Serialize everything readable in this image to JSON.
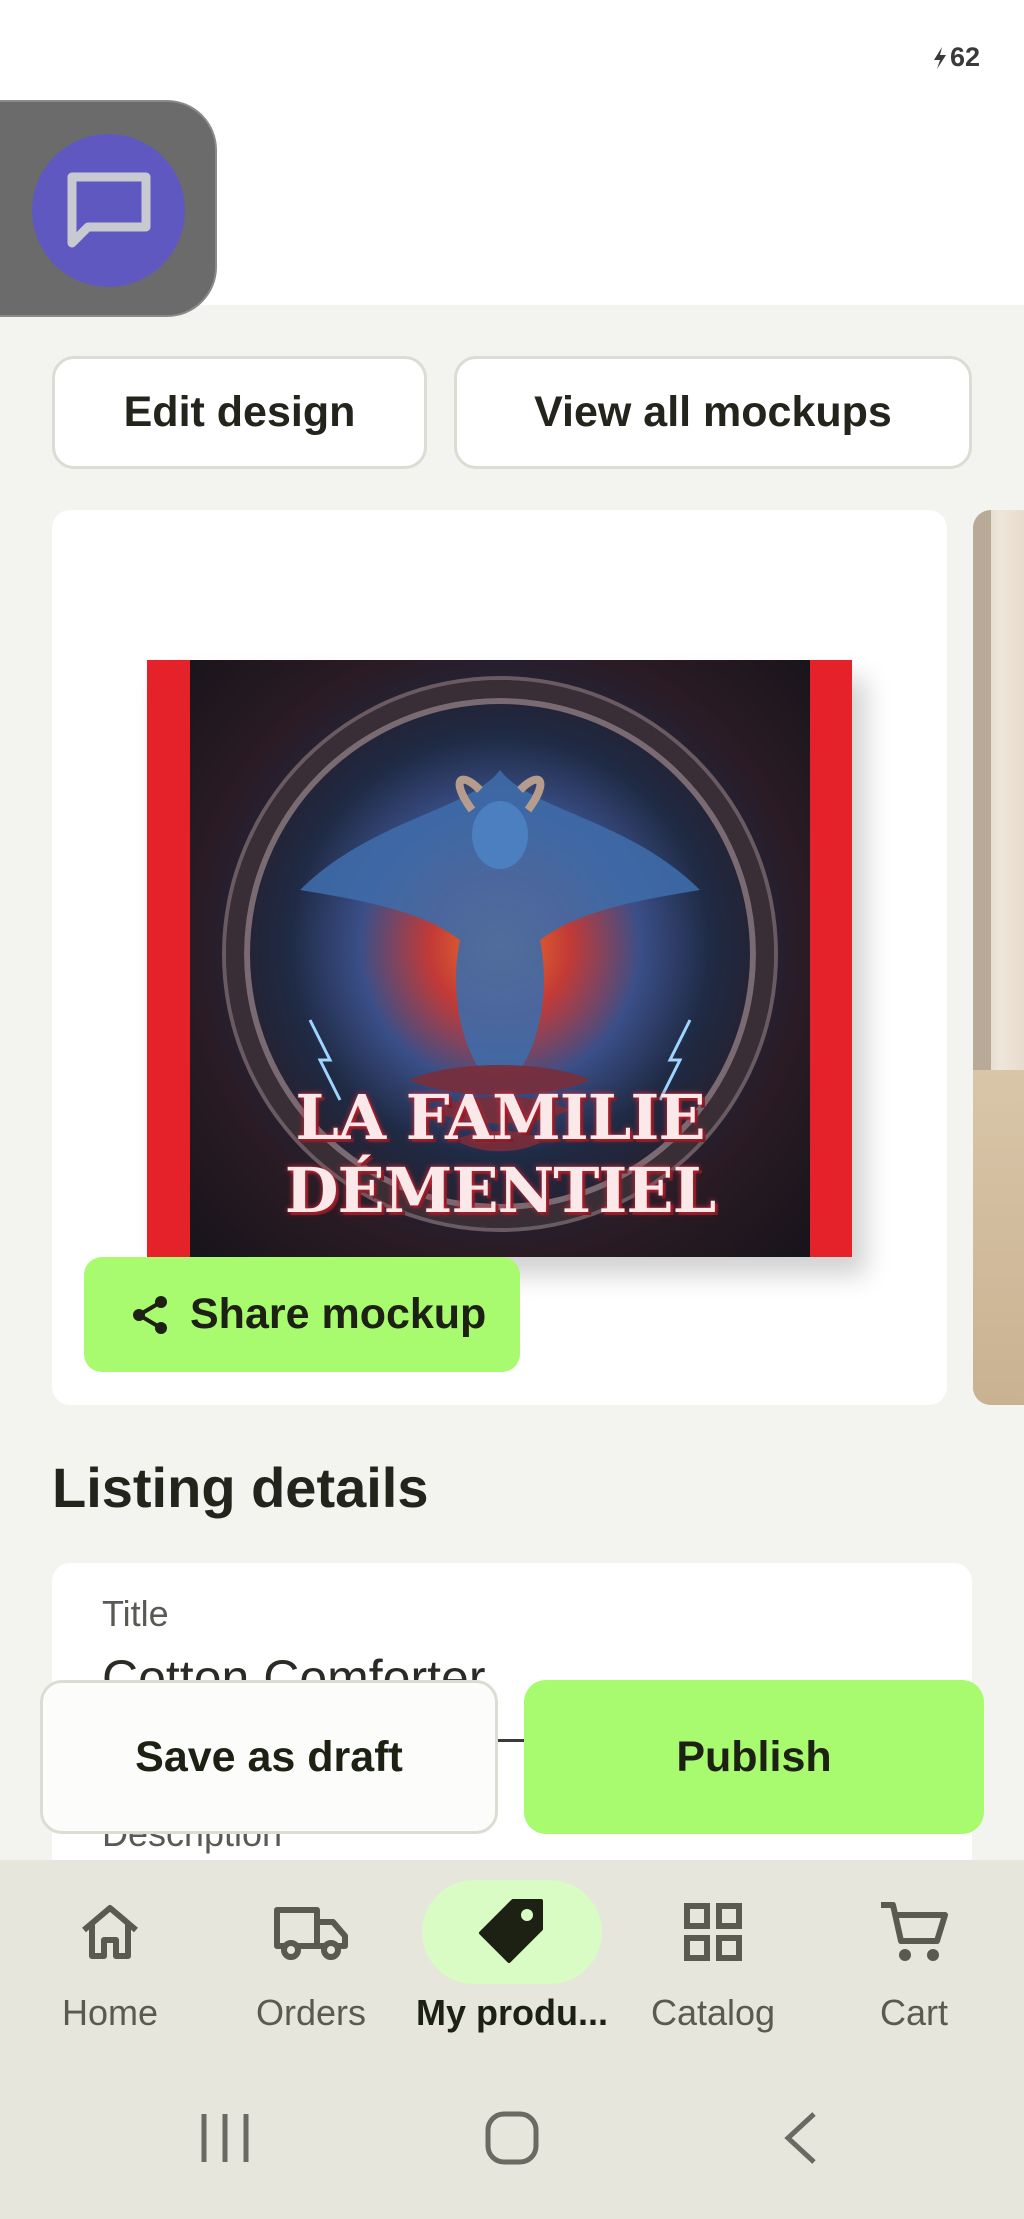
{
  "status_bar": {
    "battery_level": "62"
  },
  "chat": {
    "icon": "chat-bubble-icon"
  },
  "top_actions": {
    "edit_design": "Edit design",
    "view_all_mockups": "View all mockups"
  },
  "mockup": {
    "artwork_text": "LA FAMILIE DÉMENTIEL",
    "share_label": "Share mockup",
    "product_color": "#e5212a"
  },
  "listing": {
    "section_title": "Listing details",
    "title_label": "Title",
    "title_value": "Cotton Comforter",
    "description_label": "Description"
  },
  "actions": {
    "save_draft": "Save as draft",
    "publish": "Publish"
  },
  "nav": {
    "items": [
      {
        "label": "Home",
        "icon": "home-icon"
      },
      {
        "label": "Orders",
        "icon": "truck-icon"
      },
      {
        "label": "My produ...",
        "icon": "tag-icon",
        "active": true
      },
      {
        "label": "Catalog",
        "icon": "grid-icon"
      },
      {
        "label": "Cart",
        "icon": "cart-icon"
      }
    ]
  },
  "colors": {
    "accent": "#a8fa6e",
    "accent_soft": "#d9fbc4",
    "chat": "#5f58c0",
    "text": "#23241c"
  }
}
